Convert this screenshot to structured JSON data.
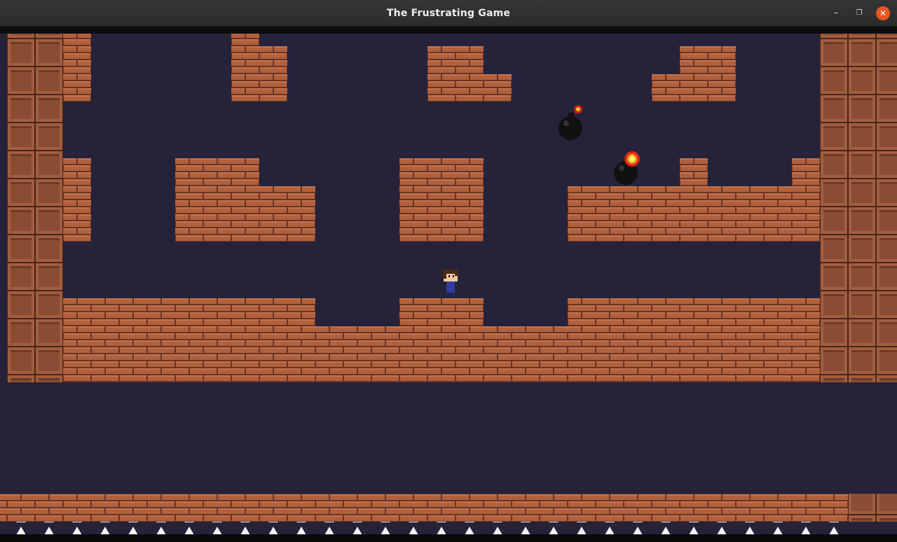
{
  "window": {
    "title": "The Frustrating Game",
    "minimize_glyph": "–",
    "maximize_glyph": "❐",
    "close_glyph": "✕"
  },
  "game": {
    "colors": {
      "sky": "#25223a",
      "brick": "#b0603c",
      "mortar": "#6a3424",
      "block": "#8a4d33",
      "spike": "#f2f2f2",
      "bomb": "#111111",
      "spark": "#f5c518"
    },
    "player_shirt_color": "#2f3e9e",
    "player_hair_color": "#4a2a18"
  }
}
